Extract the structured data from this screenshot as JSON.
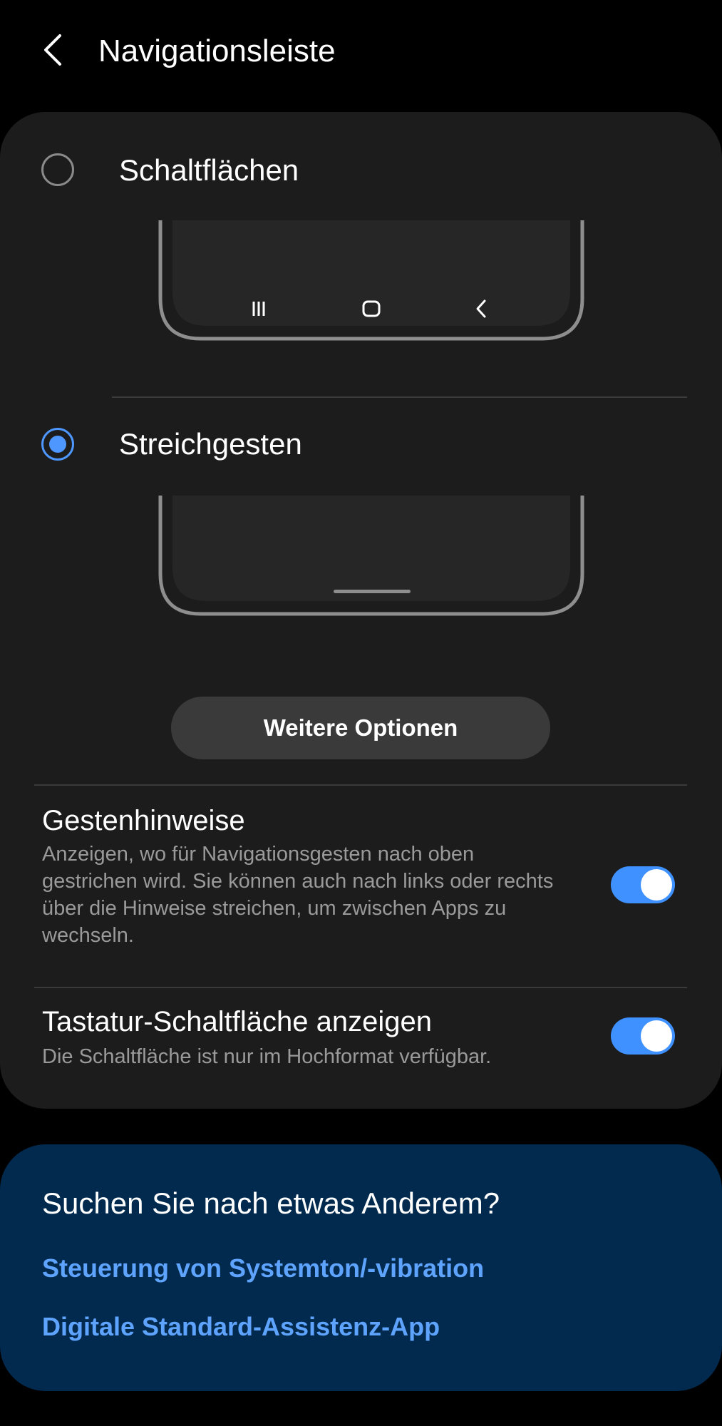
{
  "header": {
    "title": "Navigationsleiste",
    "back_icon": "chevron-left-icon"
  },
  "navigation_type": {
    "options": [
      {
        "label": "Schaltflächen",
        "selected": false,
        "preview_icons": [
          "recent-apps-icon",
          "home-icon",
          "back-icon"
        ]
      },
      {
        "label": "Streichgesten",
        "selected": true,
        "preview_icons": [
          "gesture-handle"
        ]
      }
    ],
    "more_button_label": "Weitere Optionen"
  },
  "settings": [
    {
      "title": "Gestenhinweise",
      "description": "Anzeigen, wo für Navigationsgesten nach oben gestrichen wird. Sie können auch nach links oder rechts über die Hinweise streichen, um zwischen Apps zu wechseln.",
      "enabled": true
    },
    {
      "title": "Tastatur-Schaltfläche anzeigen",
      "description": "Die Schaltfläche ist nur im Hochformat verfügbar.",
      "enabled": true
    }
  ],
  "suggestions": {
    "title": "Suchen Sie nach etwas Anderem?",
    "links": [
      "Steuerung von Systemton/-vibration",
      "Digitale Standard-Assistenz-App"
    ]
  },
  "colors": {
    "background": "#000000",
    "card": "#1c1c1c",
    "accent": "#3e91ff",
    "link": "#5ea4ff",
    "suggest_background": "#012a4e"
  }
}
